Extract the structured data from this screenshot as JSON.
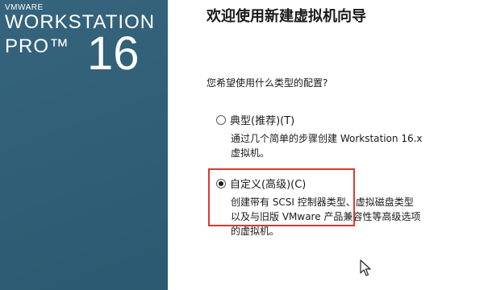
{
  "brand": {
    "vendor": "VMWARE",
    "product_line1": "WORKSTATION",
    "product_line2": "PRO™",
    "version": "16",
    "panel_color": "#2d5e77"
  },
  "wizard": {
    "title": "欢迎使用新建虚拟机向导",
    "question": "您希望使用什么类型的配置?"
  },
  "options": [
    {
      "label": "典型(推荐)(T)",
      "selected": false,
      "description": [
        "通过几个简单的步骤创建 Workstation 16.x",
        "虚拟机。"
      ]
    },
    {
      "label": "自定义(高级)(C)",
      "selected": true,
      "description": [
        "创建带有 SCSI 控制器类型、虚拟磁盘类型",
        "以及与旧版 VMware 产品兼容性等高级选项",
        "的虚拟机。"
      ]
    }
  ],
  "annotation": {
    "highlight_color": "#d93a32"
  },
  "icons": {
    "cursor": "mouse-pointer-icon"
  }
}
